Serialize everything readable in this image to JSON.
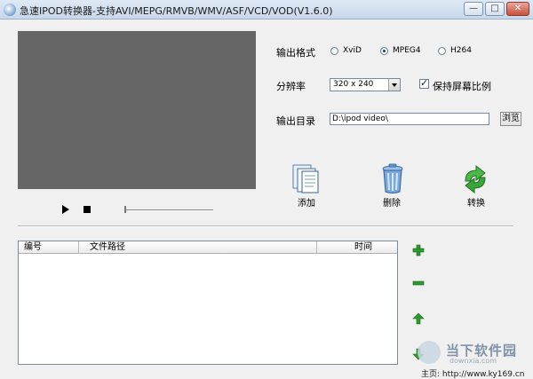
{
  "window": {
    "title": "急速IPOD转换器-支持AVI/MEPG/RMVB/WMV/ASF/VCD/VOD(V1.6.0)",
    "min_glyph": "—",
    "max_glyph": "□",
    "close_glyph": "✕"
  },
  "settings": {
    "format_label": "输出格式",
    "formats": [
      {
        "label": "XviD",
        "selected": false
      },
      {
        "label": "MPEG4",
        "selected": true
      },
      {
        "label": "H264",
        "selected": false
      }
    ],
    "resolution_label": "分辨率",
    "resolution_value": "320 x 240",
    "keep_ratio_label": "保持屏幕比例",
    "keep_ratio_checked": true,
    "outdir_label": "输出目录",
    "outdir_value": "D:\\ipod video\\",
    "browse_label": "浏览"
  },
  "toolbar": {
    "add_label": "添加",
    "delete_label": "删除",
    "convert_label": "转换"
  },
  "table": {
    "columns": [
      "编号",
      "文件路径",
      "时间"
    ],
    "rows": []
  },
  "watermark": {
    "logo_text": "当下软件园",
    "domain": "downxia.com",
    "homepage": "主页: http://www.ky169.cn"
  },
  "colors": {
    "video_bg": "#666666",
    "side_button_green": "#2e9a2e"
  },
  "icons": {
    "play": "play-icon",
    "stop": "stop-icon",
    "add": "add-files-icon",
    "delete": "trash-can-icon",
    "convert": "convert-arrows-icon",
    "side_add": "plus-icon",
    "side_remove": "minus-icon",
    "side_up": "arrow-up-icon",
    "side_down": "arrow-down-icon"
  }
}
